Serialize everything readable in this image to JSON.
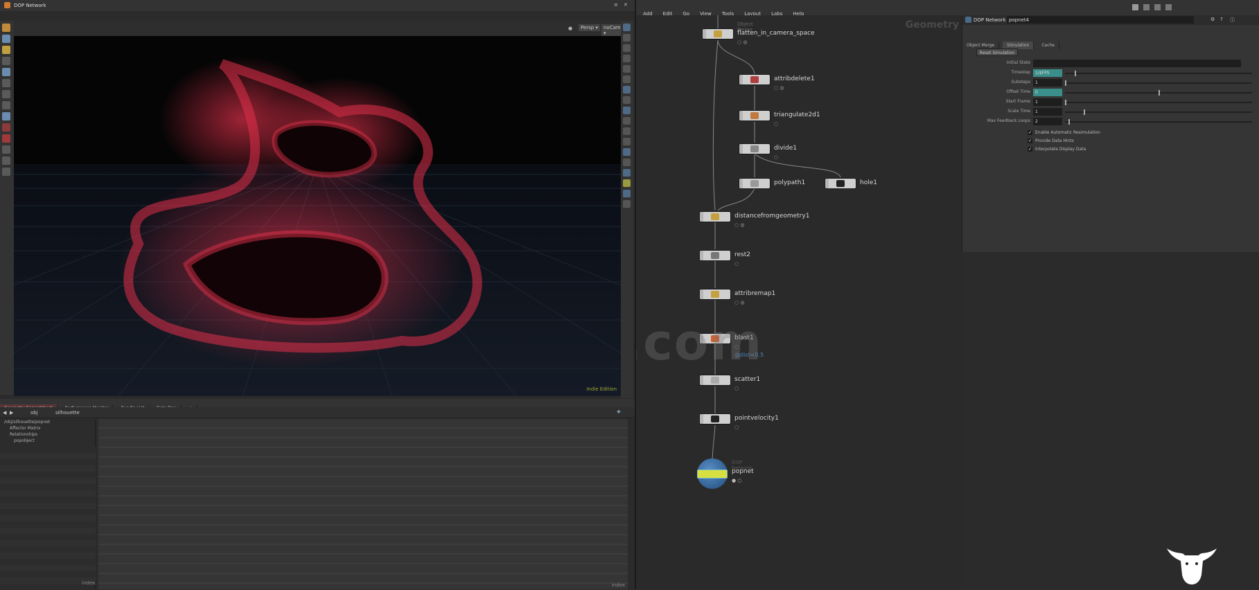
{
  "left_pane": {
    "title": "DOP Network",
    "viewport": {
      "persp_label": "Persp ▾",
      "cam_label": "noCam ▾",
      "status_text": "Indie Edition",
      "colors": {
        "particles": "#e0304a",
        "background": "#050505",
        "grid": "#1e2633"
      }
    },
    "bottom_tabs": [
      "Geometry Spreadsheet",
      "Performance Monitor",
      "Bundle List",
      "Data Tree"
    ],
    "bottom_path": [
      "obj",
      "silhouette"
    ],
    "tree": [
      "/obj/silhouette/popnet",
      "Affector Matrix",
      "Relationships",
      "popobject"
    ],
    "footer_right": "index",
    "footer_right2": "index"
  },
  "network": {
    "menu": [
      "Add",
      "Edit",
      "Go",
      "View",
      "Tools",
      "Layout",
      "Labs",
      "Help"
    ],
    "context_label": "Geometry",
    "nodes": [
      {
        "name": "flatten_in_camera_space",
        "header": "Object Merge"
      },
      {
        "name": "attribdelete1"
      },
      {
        "name": "triangulate2d1"
      },
      {
        "name": "divide1"
      },
      {
        "name": "polypath1"
      },
      {
        "name": "hole1"
      },
      {
        "name": "distancefromgeometry1"
      },
      {
        "name": "rest2"
      },
      {
        "name": "attribremap1"
      },
      {
        "name": "blast1",
        "annotation": "@dist<0.5"
      },
      {
        "name": "scatter1"
      },
      {
        "name": "pointvelocity1"
      },
      {
        "name": "popnet",
        "header": "DOP Network"
      }
    ],
    "watermark": "iiivfx.com",
    "accent": "#4b84b8"
  },
  "params": {
    "node_type": "DOP Network",
    "node_name": "popnet4",
    "tabs": [
      "Object Merge",
      "Simulation",
      "Cache"
    ],
    "reset_button": "Reset Simulation",
    "rows": [
      {
        "label": "Initial State",
        "value": ""
      },
      {
        "label": "Timestep",
        "value": "1/$FPS",
        "pos": 0.05
      },
      {
        "label": "Substeps",
        "value": "1",
        "pos": 0.0
      },
      {
        "label": "Offset Time",
        "value": "0",
        "pos": 0.5
      },
      {
        "label": "Start Frame",
        "value": "1",
        "pos": 0.0
      },
      {
        "label": "Scale Time",
        "value": "1",
        "pos": 0.1
      },
      {
        "label": "Max Feedback Loops",
        "value": "2",
        "pos": 0.02
      }
    ],
    "checks": [
      "Enable Automatic Resimulation",
      "Provide Data Hints",
      "Interpolate Display Data"
    ]
  }
}
